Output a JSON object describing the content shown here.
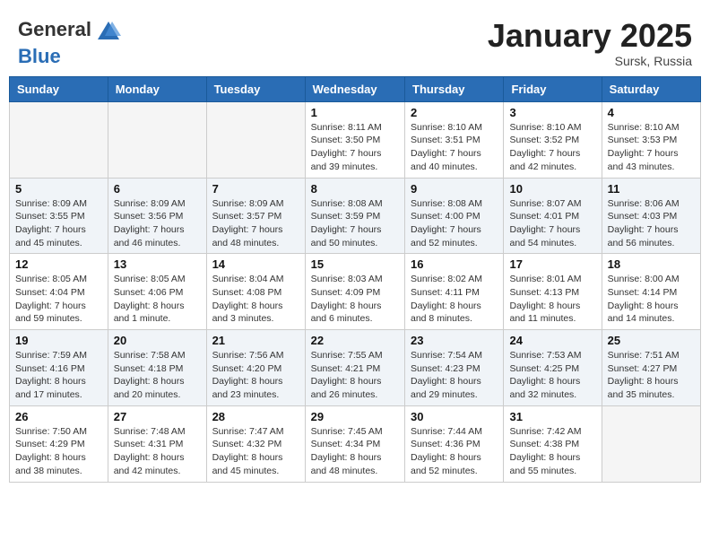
{
  "header": {
    "logo_general": "General",
    "logo_blue": "Blue",
    "title": "January 2025",
    "location": "Sursk, Russia"
  },
  "weekdays": [
    "Sunday",
    "Monday",
    "Tuesday",
    "Wednesday",
    "Thursday",
    "Friday",
    "Saturday"
  ],
  "weeks": [
    [
      {
        "day": "",
        "info": ""
      },
      {
        "day": "",
        "info": ""
      },
      {
        "day": "",
        "info": ""
      },
      {
        "day": "1",
        "info": "Sunrise: 8:11 AM\nSunset: 3:50 PM\nDaylight: 7 hours\nand 39 minutes."
      },
      {
        "day": "2",
        "info": "Sunrise: 8:10 AM\nSunset: 3:51 PM\nDaylight: 7 hours\nand 40 minutes."
      },
      {
        "day": "3",
        "info": "Sunrise: 8:10 AM\nSunset: 3:52 PM\nDaylight: 7 hours\nand 42 minutes."
      },
      {
        "day": "4",
        "info": "Sunrise: 8:10 AM\nSunset: 3:53 PM\nDaylight: 7 hours\nand 43 minutes."
      }
    ],
    [
      {
        "day": "5",
        "info": "Sunrise: 8:09 AM\nSunset: 3:55 PM\nDaylight: 7 hours\nand 45 minutes."
      },
      {
        "day": "6",
        "info": "Sunrise: 8:09 AM\nSunset: 3:56 PM\nDaylight: 7 hours\nand 46 minutes."
      },
      {
        "day": "7",
        "info": "Sunrise: 8:09 AM\nSunset: 3:57 PM\nDaylight: 7 hours\nand 48 minutes."
      },
      {
        "day": "8",
        "info": "Sunrise: 8:08 AM\nSunset: 3:59 PM\nDaylight: 7 hours\nand 50 minutes."
      },
      {
        "day": "9",
        "info": "Sunrise: 8:08 AM\nSunset: 4:00 PM\nDaylight: 7 hours\nand 52 minutes."
      },
      {
        "day": "10",
        "info": "Sunrise: 8:07 AM\nSunset: 4:01 PM\nDaylight: 7 hours\nand 54 minutes."
      },
      {
        "day": "11",
        "info": "Sunrise: 8:06 AM\nSunset: 4:03 PM\nDaylight: 7 hours\nand 56 minutes."
      }
    ],
    [
      {
        "day": "12",
        "info": "Sunrise: 8:05 AM\nSunset: 4:04 PM\nDaylight: 7 hours\nand 59 minutes."
      },
      {
        "day": "13",
        "info": "Sunrise: 8:05 AM\nSunset: 4:06 PM\nDaylight: 8 hours\nand 1 minute."
      },
      {
        "day": "14",
        "info": "Sunrise: 8:04 AM\nSunset: 4:08 PM\nDaylight: 8 hours\nand 3 minutes."
      },
      {
        "day": "15",
        "info": "Sunrise: 8:03 AM\nSunset: 4:09 PM\nDaylight: 8 hours\nand 6 minutes."
      },
      {
        "day": "16",
        "info": "Sunrise: 8:02 AM\nSunset: 4:11 PM\nDaylight: 8 hours\nand 8 minutes."
      },
      {
        "day": "17",
        "info": "Sunrise: 8:01 AM\nSunset: 4:13 PM\nDaylight: 8 hours\nand 11 minutes."
      },
      {
        "day": "18",
        "info": "Sunrise: 8:00 AM\nSunset: 4:14 PM\nDaylight: 8 hours\nand 14 minutes."
      }
    ],
    [
      {
        "day": "19",
        "info": "Sunrise: 7:59 AM\nSunset: 4:16 PM\nDaylight: 8 hours\nand 17 minutes."
      },
      {
        "day": "20",
        "info": "Sunrise: 7:58 AM\nSunset: 4:18 PM\nDaylight: 8 hours\nand 20 minutes."
      },
      {
        "day": "21",
        "info": "Sunrise: 7:56 AM\nSunset: 4:20 PM\nDaylight: 8 hours\nand 23 minutes."
      },
      {
        "day": "22",
        "info": "Sunrise: 7:55 AM\nSunset: 4:21 PM\nDaylight: 8 hours\nand 26 minutes."
      },
      {
        "day": "23",
        "info": "Sunrise: 7:54 AM\nSunset: 4:23 PM\nDaylight: 8 hours\nand 29 minutes."
      },
      {
        "day": "24",
        "info": "Sunrise: 7:53 AM\nSunset: 4:25 PM\nDaylight: 8 hours\nand 32 minutes."
      },
      {
        "day": "25",
        "info": "Sunrise: 7:51 AM\nSunset: 4:27 PM\nDaylight: 8 hours\nand 35 minutes."
      }
    ],
    [
      {
        "day": "26",
        "info": "Sunrise: 7:50 AM\nSunset: 4:29 PM\nDaylight: 8 hours\nand 38 minutes."
      },
      {
        "day": "27",
        "info": "Sunrise: 7:48 AM\nSunset: 4:31 PM\nDaylight: 8 hours\nand 42 minutes."
      },
      {
        "day": "28",
        "info": "Sunrise: 7:47 AM\nSunset: 4:32 PM\nDaylight: 8 hours\nand 45 minutes."
      },
      {
        "day": "29",
        "info": "Sunrise: 7:45 AM\nSunset: 4:34 PM\nDaylight: 8 hours\nand 48 minutes."
      },
      {
        "day": "30",
        "info": "Sunrise: 7:44 AM\nSunset: 4:36 PM\nDaylight: 8 hours\nand 52 minutes."
      },
      {
        "day": "31",
        "info": "Sunrise: 7:42 AM\nSunset: 4:38 PM\nDaylight: 8 hours\nand 55 minutes."
      },
      {
        "day": "",
        "info": ""
      }
    ]
  ]
}
